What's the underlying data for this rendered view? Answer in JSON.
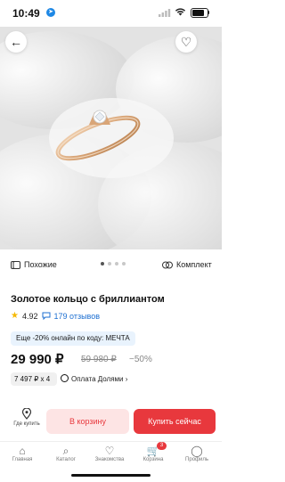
{
  "status": {
    "time": "10:49"
  },
  "photo": {
    "alt_marks": "ring-photo"
  },
  "photo_controls": {
    "back_icon": "←",
    "favorite_icon": "♡",
    "dots_total": 4,
    "dot_active": 1
  },
  "chips": {
    "similar": "Похожие",
    "set": "Комплект"
  },
  "product": {
    "title": "Золотое кольцо с бриллиантом",
    "rating": "4.92",
    "reviews": "179 отзывов",
    "promo": "Еще -20% онлайн по коду: МЕЧТА",
    "price": "29 990 ₽",
    "old_price": "59 980 ₽",
    "discount": "−50%",
    "split_amount": "7 497 ₽ x 4",
    "split_label": "Оплата Долями ›"
  },
  "buy": {
    "pickup_label": "Где купить",
    "cart_label": "В корзину",
    "buy_now_label": "Купить сейчас"
  },
  "tabs": [
    {
      "label": "Главная",
      "icon": "⌂"
    },
    {
      "label": "Каталог",
      "icon": "⌕"
    },
    {
      "label": "Знакомства",
      "icon": "♡"
    },
    {
      "label": "Корзина",
      "icon": "🛒",
      "badge": "3"
    },
    {
      "label": "Профиль",
      "icon": "◯"
    }
  ]
}
